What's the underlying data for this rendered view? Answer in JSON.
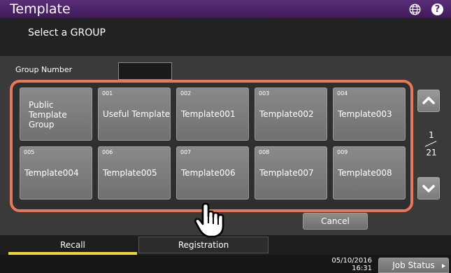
{
  "header": {
    "title": "Template",
    "subtitle": "Select a GROUP",
    "help_label": "?"
  },
  "group_number": {
    "label": "Group Number",
    "value": ""
  },
  "tiles": [
    {
      "number": "",
      "name": "Public Template Group"
    },
    {
      "number": "001",
      "name": "Useful Template"
    },
    {
      "number": "002",
      "name": "Template001"
    },
    {
      "number": "003",
      "name": "Template002"
    },
    {
      "number": "004",
      "name": "Template003"
    },
    {
      "number": "005",
      "name": "Template004"
    },
    {
      "number": "006",
      "name": "Template005"
    },
    {
      "number": "007",
      "name": "Template006"
    },
    {
      "number": "008",
      "name": "Template007"
    },
    {
      "number": "009",
      "name": "Template008"
    }
  ],
  "pagination": {
    "current": "1",
    "total": "21"
  },
  "cancel_label": "Cancel",
  "tabs": {
    "recall": "Recall",
    "registration": "Registration"
  },
  "footer": {
    "date": "05/10/2016",
    "time": "16:31",
    "job_status": "Job Status"
  },
  "colors": {
    "title_bar": "#5b2e78",
    "highlight_frame": "#e9785a",
    "active_tab": "#f2d43a"
  }
}
